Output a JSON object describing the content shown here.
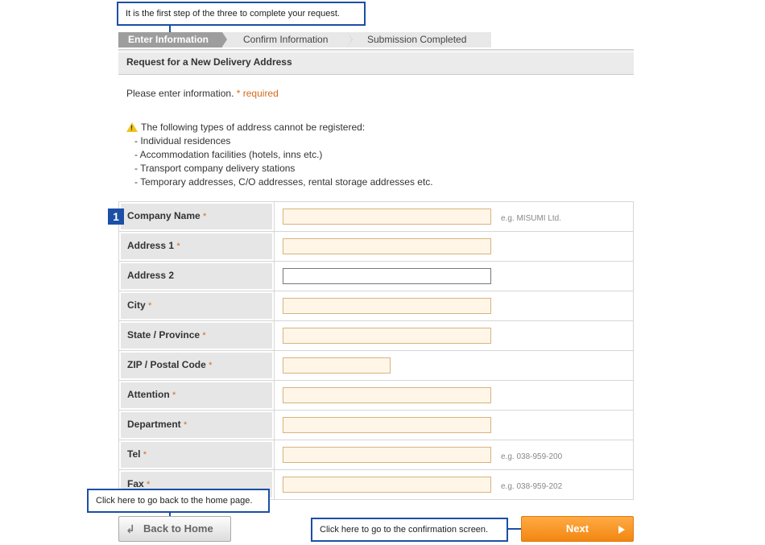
{
  "callouts": {
    "top": "It is the first step of the three to complete your request.",
    "back": "Click here to go back to the home page.",
    "next": "Click here to go to the confirmation screen."
  },
  "steps": [
    "Enter Information",
    "Confirm Information",
    "Submission Completed"
  ],
  "section_title": "Request for a New Delivery Address",
  "intro": {
    "text": "Please enter information.",
    "required_note": "* required"
  },
  "warning": {
    "title": "The following types of address cannot be registered:",
    "items": [
      "- Individual residences",
      "- Accommodation facilities (hotels, inns etc.)",
      "- Transport company delivery stations",
      "- Temporary addresses, C/O addresses, rental storage addresses etc."
    ]
  },
  "badge": "1",
  "fields": [
    {
      "label": "Company Name",
      "required": "*",
      "example": "e.g. MISUMI Ltd."
    },
    {
      "label": "Address 1",
      "required": "*",
      "example": ""
    },
    {
      "label": "Address 2",
      "required": "",
      "example": ""
    },
    {
      "label": "City",
      "required": "*",
      "example": ""
    },
    {
      "label": "State / Province",
      "required": "*",
      "example": ""
    },
    {
      "label": "ZIP / Postal Code",
      "required": "*",
      "example": ""
    },
    {
      "label": "Attention",
      "required": "*",
      "example": ""
    },
    {
      "label": "Department",
      "required": "*",
      "example": ""
    },
    {
      "label": "Tel",
      "required": "*",
      "example": "e.g. 038-959-200"
    },
    {
      "label": "Fax",
      "required": "*",
      "example": "e.g. 038-959-202"
    }
  ],
  "buttons": {
    "back": "Back to Home",
    "next": "Next"
  },
  "colors": {
    "accent": "#1c4fa6",
    "required": "#d46b1b",
    "next_button": "#f28611"
  }
}
